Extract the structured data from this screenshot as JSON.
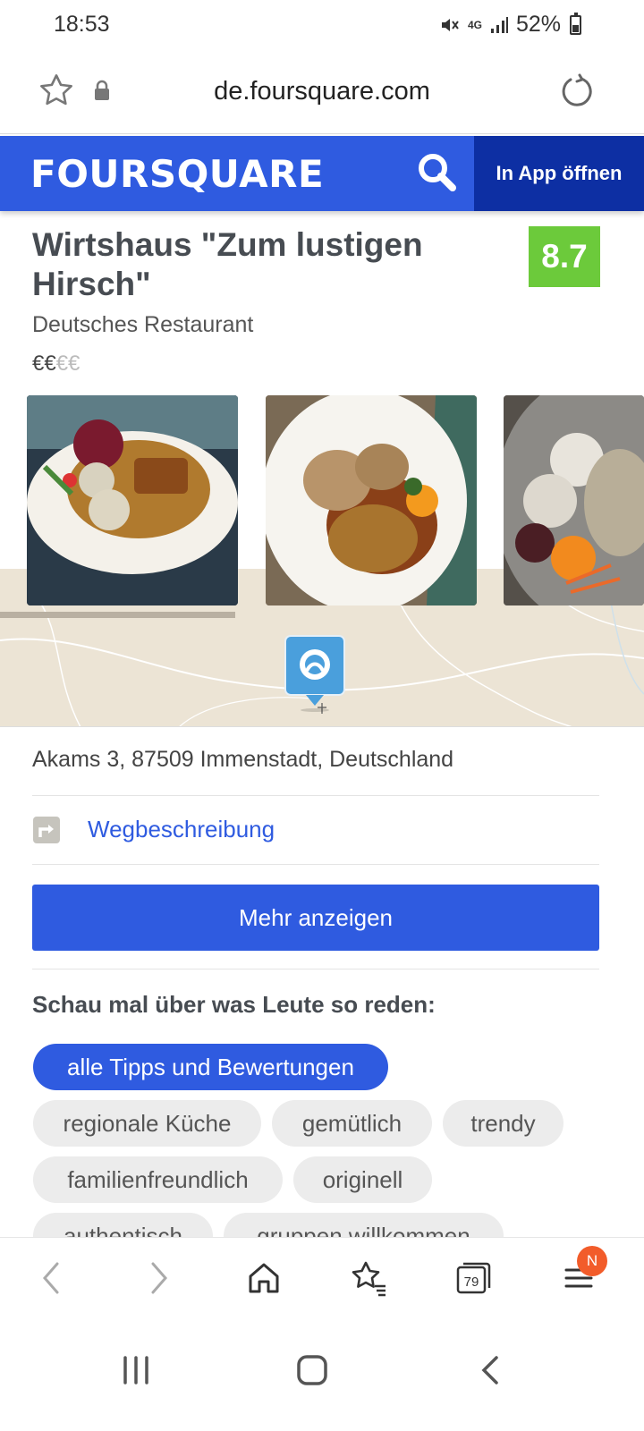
{
  "status": {
    "time": "18:53",
    "network": "4G",
    "battery": "52%"
  },
  "browser": {
    "url": "de.foursquare.com",
    "tab_count": "79",
    "menu_badge": "N"
  },
  "header": {
    "logo": "FOURSQUARE",
    "open_in_app": "In App öffnen"
  },
  "venue": {
    "name": "Wirtshaus \"Zum lustigen Hirsch\"",
    "rating": "8.7",
    "rating_color": "#6cca3b",
    "category": "Deutsches Restaurant",
    "price_active": "€€",
    "price_inactive": "€€",
    "address": "Akams 3, 87509 Immenstadt, Deutschland",
    "directions": "Wegbeschreibung",
    "more_button": "Mehr anzeigen"
  },
  "tips": {
    "heading": "Schau mal über was Leute so reden:",
    "tags": [
      "alle Tipps und Bewertungen",
      "regionale Küche",
      "gemütlich",
      "trendy",
      "familienfreundlich",
      "originell",
      "authentisch",
      "gruppen willkommen"
    ]
  },
  "colors": {
    "brand_blue": "#2f5be0",
    "brand_dark_blue": "#0d2fa3"
  }
}
